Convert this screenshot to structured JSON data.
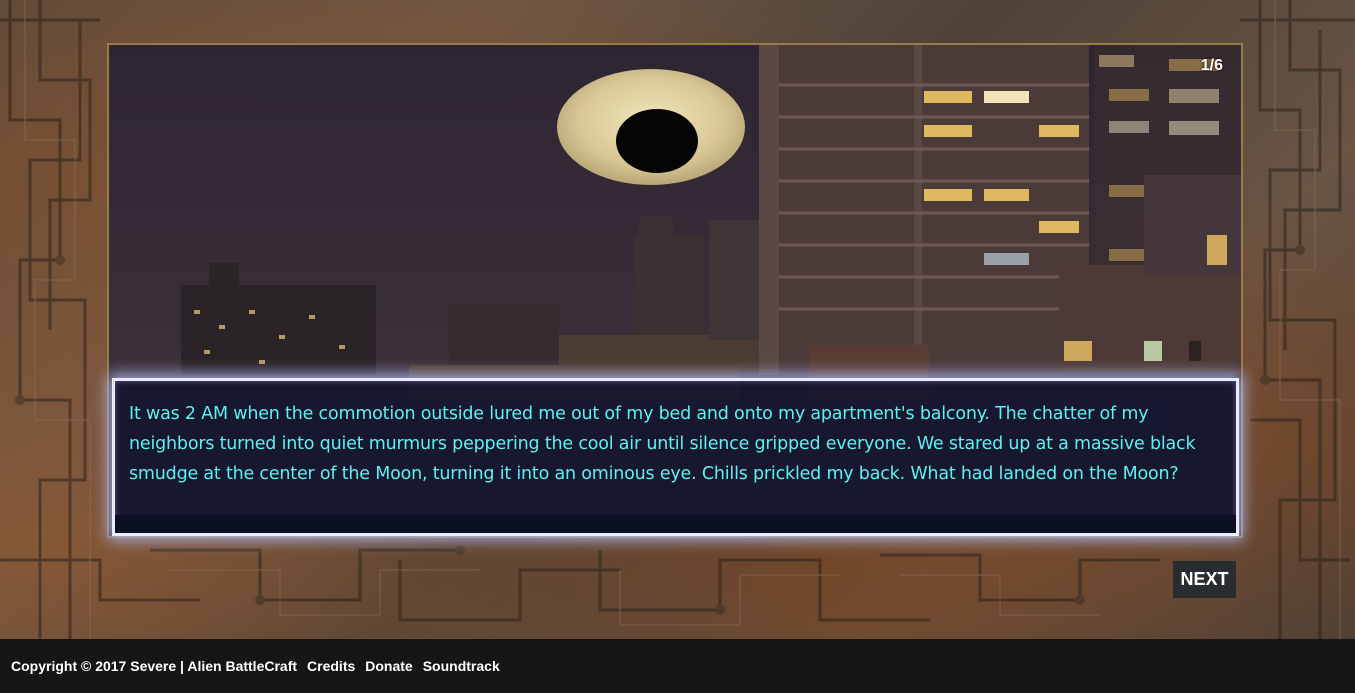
{
  "scene": {
    "counter": "1/6",
    "illustration": "city-night-moon-eye"
  },
  "dialog": {
    "text": "It was 2 AM when the commotion outside lured me out of my bed and onto my apartment's balcony. The chatter of my neighbors turned into quiet murmurs peppering the cool air until silence gripped everyone. We stared up at a massive black smudge at the center of the Moon, turning it into an ominous eye. Chills prickled my back. What had landed on the Moon?"
  },
  "controls": {
    "next_label": "NEXT"
  },
  "footer": {
    "copyright": "Copyright © 2017 Severe | Alien BattleCraft",
    "links": [
      "Credits",
      "Donate",
      "Soundtrack"
    ]
  },
  "colors": {
    "dialog_text": "#5ff0f0",
    "dialog_bg": "#12142f",
    "dialog_border": "#e8ecff",
    "frame_border": "#9a7a45",
    "footer_bg": "#161616",
    "next_bg": "#2a2d30"
  }
}
